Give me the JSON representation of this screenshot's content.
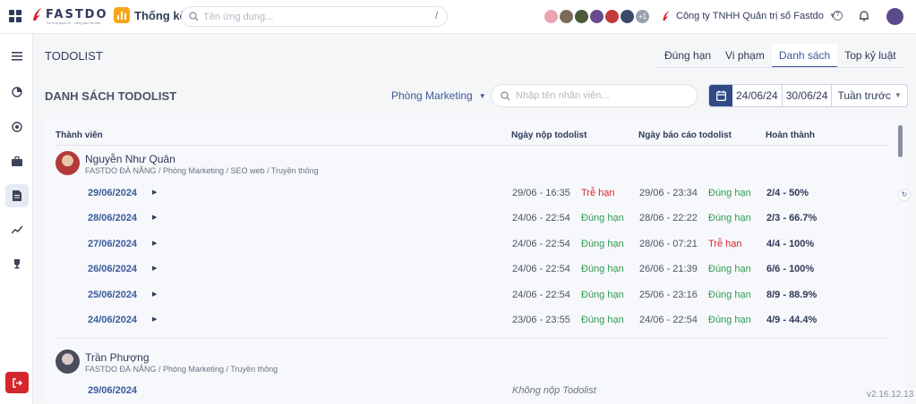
{
  "topbar": {
    "logo_text": "FASTDO",
    "logo_tagline": "Số hóa quản trị · Lãng đạo tài tiến",
    "module_label": "Thống kê",
    "search_placeholder": "Tên ứng dụng...",
    "search_shortcut": "/",
    "avatars_more": "+1",
    "company": "Công ty TNHH Quản trị số Fastdo"
  },
  "page": {
    "title": "TODOLIST",
    "section_title": "DANH SÁCH TODOLIST",
    "tabs": [
      "Đúng hạn",
      "Vi phạm",
      "Danh sách",
      "Top kỷ luật"
    ],
    "active_tab": "Danh sách"
  },
  "filters": {
    "department": "Phòng Marketing",
    "employee_search_placeholder": "Nhập tên nhân viên...",
    "date_from": "24/06/24",
    "date_to": "30/06/24",
    "period": "Tuần trước"
  },
  "table": {
    "headers": [
      "Thành viên",
      "Ngày nộp todolist",
      "Ngày báo cáo todolist",
      "Hoàn thành"
    ],
    "members": [
      {
        "name": "Nguyễn Như Quân",
        "path": "FASTDO ĐÀ NẴNG / Phòng Marketing / SEO web / Truyền thông",
        "days": [
          {
            "date": "29/06/2024",
            "submit": "29/06 - 16:35",
            "submit_status": "Trễ hạn",
            "report": "29/06 - 23:34",
            "report_status": "Đúng hạn",
            "complete": "2/4 - 50%"
          },
          {
            "date": "28/06/2024",
            "submit": "24/06 - 22:54",
            "submit_status": "Đúng hạn",
            "report": "28/06 - 22:22",
            "report_status": "Đúng hạn",
            "complete": "2/3 - 66.7%"
          },
          {
            "date": "27/06/2024",
            "submit": "24/06 - 22:54",
            "submit_status": "Đúng hạn",
            "report": "28/06 - 07:21",
            "report_status": "Trễ hạn",
            "complete": "4/4 - 100%"
          },
          {
            "date": "26/06/2024",
            "submit": "24/06 - 22:54",
            "submit_status": "Đúng hạn",
            "report": "26/06 - 21:39",
            "report_status": "Đúng hạn",
            "complete": "6/6 - 100%"
          },
          {
            "date": "25/06/2024",
            "submit": "24/06 - 22:54",
            "submit_status": "Đúng hạn",
            "report": "25/06 - 23:16",
            "report_status": "Đúng hạn",
            "complete": "8/9 - 88.9%"
          },
          {
            "date": "24/06/2024",
            "submit": "23/06 - 23:55",
            "submit_status": "Đúng hạn",
            "report": "24/06 - 22:54",
            "report_status": "Đúng hạn",
            "complete": "4/9 - 44.4%"
          }
        ]
      },
      {
        "name": "Trần Phượng",
        "path": "FASTDO ĐÀ NẴNG / Phòng Marketing / Truyền thông",
        "days": [
          {
            "date": "29/06/2024",
            "note": "Không nộp Todolist"
          }
        ]
      }
    ]
  },
  "version": "v2.16.12.13",
  "colors": {
    "accent": "#3a5a9a",
    "ok": "#2f9c52",
    "late": "#d6262b",
    "brand_red": "#d6262b",
    "module_orange": "#f7a51c"
  }
}
